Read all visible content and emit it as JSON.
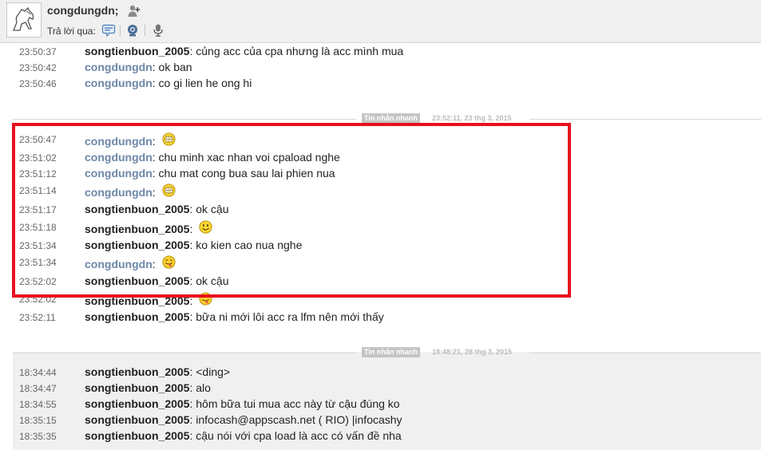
{
  "header": {
    "contact_name": "congdungdn;",
    "reply_label": "Trả lời qua:",
    "reply_icons": [
      "chat-bubble-icon",
      "webcam-icon",
      "microphone-icon"
    ]
  },
  "dividers": [
    {
      "tag": "Tin nhắn nhanh",
      "timestamp": "23:52:11, 23 thg 3, 2015"
    },
    {
      "tag": "Tin nhắn nhanh",
      "timestamp": "18:48:21, 28 thg 3, 2015"
    }
  ],
  "messages_top": [
    {
      "time": "23:50:37",
      "sender": "songtienbuon_2005",
      "who": "them",
      "text": "củng acc của cpa nhưng là acc mình mua"
    },
    {
      "time": "23:50:42",
      "sender": "congdungdn",
      "who": "me",
      "text": "ok ban"
    },
    {
      "time": "23:50:46",
      "sender": "congdungdn",
      "who": "me",
      "text": "co gi lien he ong hi"
    }
  ],
  "messages_mid": [
    {
      "time": "23:50:47",
      "sender": "congdungdn",
      "who": "me",
      "text": "",
      "emoji": "grin"
    },
    {
      "time": "23:51:02",
      "sender": "congdungdn",
      "who": "me",
      "text": "chu minh xac nhan voi cpaload nghe"
    },
    {
      "time": "23:51:12",
      "sender": "congdungdn",
      "who": "me",
      "text": "chu mat cong bua sau lai phien nua"
    },
    {
      "time": "23:51:14",
      "sender": "congdungdn",
      "who": "me",
      "text": "",
      "emoji": "grin"
    },
    {
      "time": "23:51:17",
      "sender": "songtienbuon_2005",
      "who": "them",
      "text": "ok cậu"
    },
    {
      "time": "23:51:18",
      "sender": "songtienbuon_2005",
      "who": "them",
      "text": "",
      "emoji": "smile"
    },
    {
      "time": "23:51:34",
      "sender": "songtienbuon_2005",
      "who": "them",
      "text": "ko kien cao nua nghe"
    },
    {
      "time": "23:51:34",
      "sender": "congdungdn",
      "who": "me",
      "text": "",
      "emoji": "tongue"
    },
    {
      "time": "23:52:02",
      "sender": "songtienbuon_2005",
      "who": "them",
      "text": "ok cậu"
    },
    {
      "time": "23:52:02",
      "sender": "songtienbuon_2005",
      "who": "them",
      "text": "",
      "emoji": "tongue"
    },
    {
      "time": "23:52:11",
      "sender": "songtienbuon_2005",
      "who": "them",
      "text": "bữa ni mới lôi acc ra lfm nên mới thấy"
    }
  ],
  "messages_bottom": [
    {
      "time": "18:34:44",
      "sender": "songtienbuon_2005",
      "who": "them",
      "text": "<ding>"
    },
    {
      "time": "18:34:47",
      "sender": "songtienbuon_2005",
      "who": "them",
      "text": "alo"
    },
    {
      "time": "18:34:55",
      "sender": "songtienbuon_2005",
      "who": "them",
      "text": "hôm bữa tui mua acc này từ cậu đúng ko"
    },
    {
      "time": "18:35:15",
      "sender": "songtienbuon_2005",
      "who": "them",
      "text": "infocash@appscash.net ( RIO) |infocashy"
    },
    {
      "time": "18:35:35",
      "sender": "songtienbuon_2005",
      "who": "them",
      "text": "cậu nói với cpa load là acc có vấn đề nha"
    }
  ],
  "colors": {
    "highlight": "#e8101e",
    "me_sender": "#6d87a8",
    "them_sender": "#222222"
  }
}
